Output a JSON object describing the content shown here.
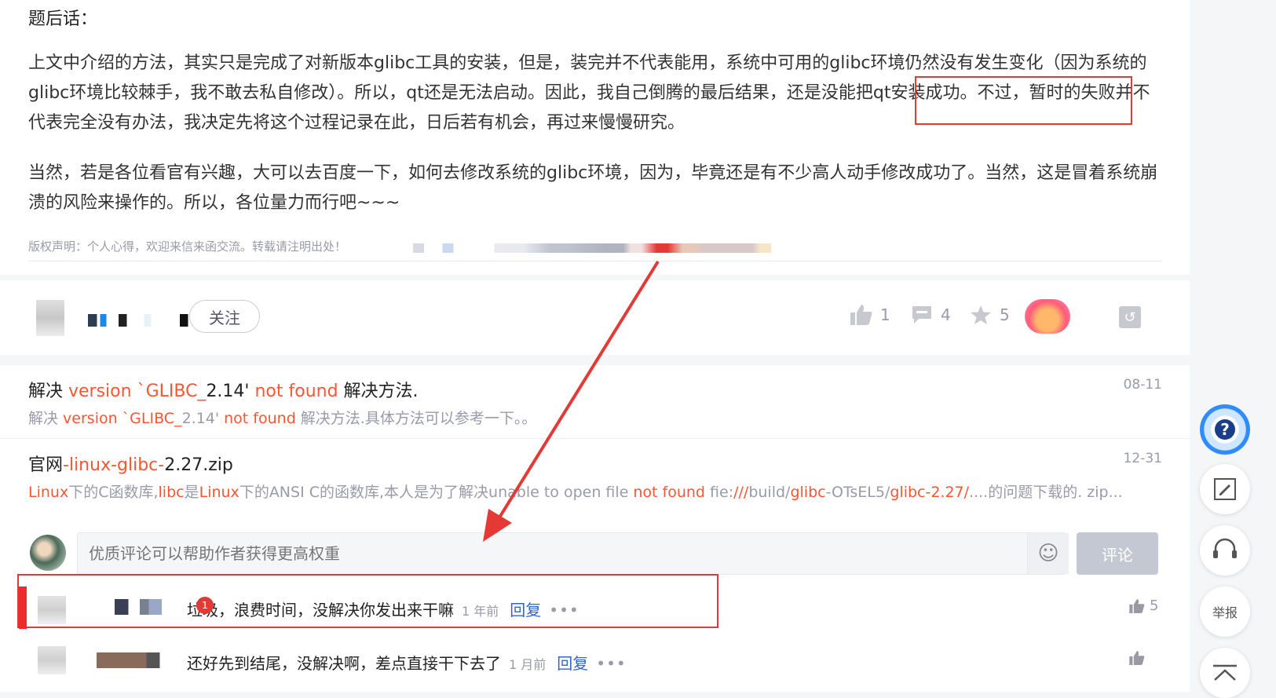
{
  "article": {
    "epilogue": "题后话：",
    "p1_a": "上文中介绍的方法，其实只是完成了对新版本glibc工具的安装，但是，装完并不代表能用，系统中可用的glibc环境仍然没有发生变化（因为系统的glibc环境比较棘手，我不敢去私自修改）。所以，qt还是无法启动。因此，我自己倒腾的最后结果，",
    "p1_boxed": "还是没能把qt安装成功。",
    "p1_b": "不过，暂时的失败并不代表完全没有办法，我决定先将这个过程记录在此，日后若有机会，再过来慢慢研究。",
    "p2": "当然，若是各位看官有兴趣，大可以去百度一下，如何去修改系统的glibc环境，因为，毕竟还是有不少高人动手修改成功了。当然，这是冒着系统崩溃的风险来操作的。所以，各位量力而行吧~~~",
    "copyright": "版权声明：个人心得，欢迎来信来函交流。转载请注明出处！"
  },
  "author_bar": {
    "follow_label": "关注",
    "likes": "1",
    "comments": "4",
    "favorites": "5"
  },
  "recommendations": [
    {
      "t1": "解决 ",
      "t2": "version `GLIBC_",
      "t3": "2.14' ",
      "t4": "not found",
      "t5": " 解决方法.",
      "d1": "解决 ",
      "d2": "version `GLIBC_",
      "d3": "2.14' ",
      "d4": "not found",
      "d5": " 解决方法.具体方法可以参考一下。。",
      "date": "08-11"
    },
    {
      "t1": "官网",
      "t2": "-linux-glibc-",
      "t3": "2.27.zip",
      "d1": "Linux",
      "d2": "下的C函数库,",
      "d3": "libc",
      "d4": "是",
      "d5": "Linux",
      "d6": "下的ANSI C的函数库,本人是为了解决unable to open file ",
      "d7": "not found",
      "d8": " fie:",
      "d9": "///",
      "d10": "build/",
      "d11": "glibc",
      "d12": "-OTsEL5/",
      "d13": "glibc-2.27/",
      "d14": "....的问题下载的. zip...",
      "date": "12-31"
    }
  ],
  "comment_box": {
    "placeholder": "优质评论可以帮助作者获得更高权重",
    "submit_label": "评论"
  },
  "comments": [
    {
      "text": "垃圾，浪费时间，没解决你发出来干嘛",
      "time": "1 年前",
      "reply": "回复",
      "more": "•••",
      "likes": "5"
    },
    {
      "text": "还好先到结尾，没解决啊，差点直接干下去了",
      "time": "1 月前",
      "reply": "回复",
      "more": "•••",
      "likes": ""
    }
  ],
  "sidebar": {
    "report_label": "举报"
  },
  "colors": {
    "annotation_red": "#e53935",
    "link_blue": "#3366cc",
    "keyword_orange": "#fc5531"
  }
}
